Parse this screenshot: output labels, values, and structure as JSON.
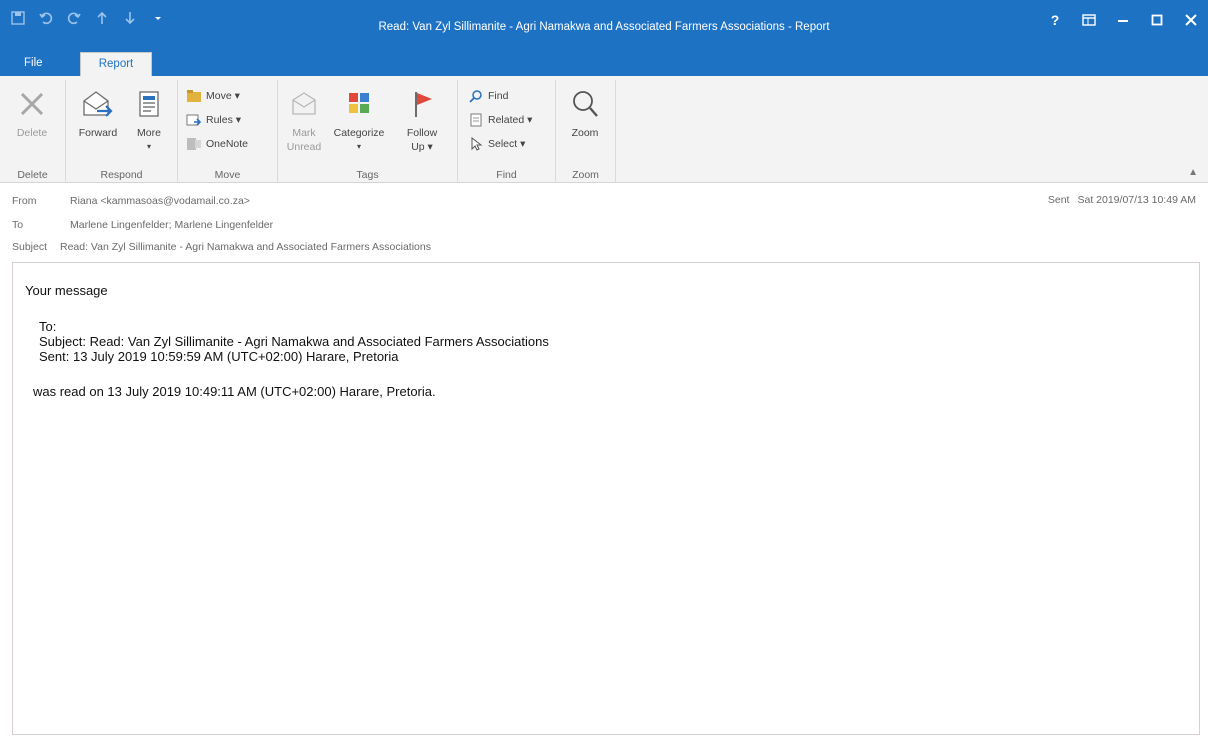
{
  "window": {
    "title": "Read: Van Zyl Sillimanite - Agri Namakwa and Associated Farmers Associations - Report",
    "accent": "#1e72c4",
    "controls": [
      "?",
      "restore-icon",
      "—",
      "□",
      "✕"
    ]
  },
  "quick_access": [
    "save-icon",
    "undo-icon",
    "redo-icon",
    "up-icon",
    "down-icon",
    "customize-icon"
  ],
  "tabs": {
    "file": "File",
    "report": "Report"
  },
  "ribbon": {
    "delete": {
      "button": "Delete",
      "group": "Delete"
    },
    "respond": {
      "forward": "Forward",
      "more": "More",
      "group": "Respond"
    },
    "move": {
      "move": "Move ▾",
      "rules": "Rules ▾",
      "onenote": "OneNote",
      "group": "Move"
    },
    "tags": {
      "mark_unread_1": "Mark",
      "mark_unread_2": "Unread",
      "categorize": "Categorize",
      "follow_up_1": "Follow",
      "follow_up_2": "Up ▾",
      "group": "Tags"
    },
    "find": {
      "find": "Find",
      "related": "Related ▾",
      "select": "Select ▾",
      "group": "Find"
    },
    "zoom": {
      "zoom": "Zoom",
      "group": "Zoom"
    }
  },
  "header": {
    "from_label": "From",
    "from_value": "Riana <kammasoas@vodamail.co.za>",
    "to_label": "To",
    "to_value": "Marlene Lingenfelder; Marlene Lingenfelder",
    "subject_label": "Subject",
    "subject_value": "Read: Van Zyl Sillimanite - Agri Namakwa and Associated Farmers Associations",
    "sent_label": "Sent",
    "sent_value": "Sat 2019/07/13 10:49 AM"
  },
  "body": {
    "heading": "Your message",
    "to_line": "To:",
    "subject_line": "Subject: Read: Van Zyl Sillimanite - Agri Namakwa and Associated Farmers Associations",
    "sent_line": "Sent: 13 July 2019 10:59:59 AM (UTC+02:00) Harare, Pretoria",
    "read_line": "was read on 13 July 2019 10:49:11 AM (UTC+02:00) Harare, Pretoria."
  }
}
